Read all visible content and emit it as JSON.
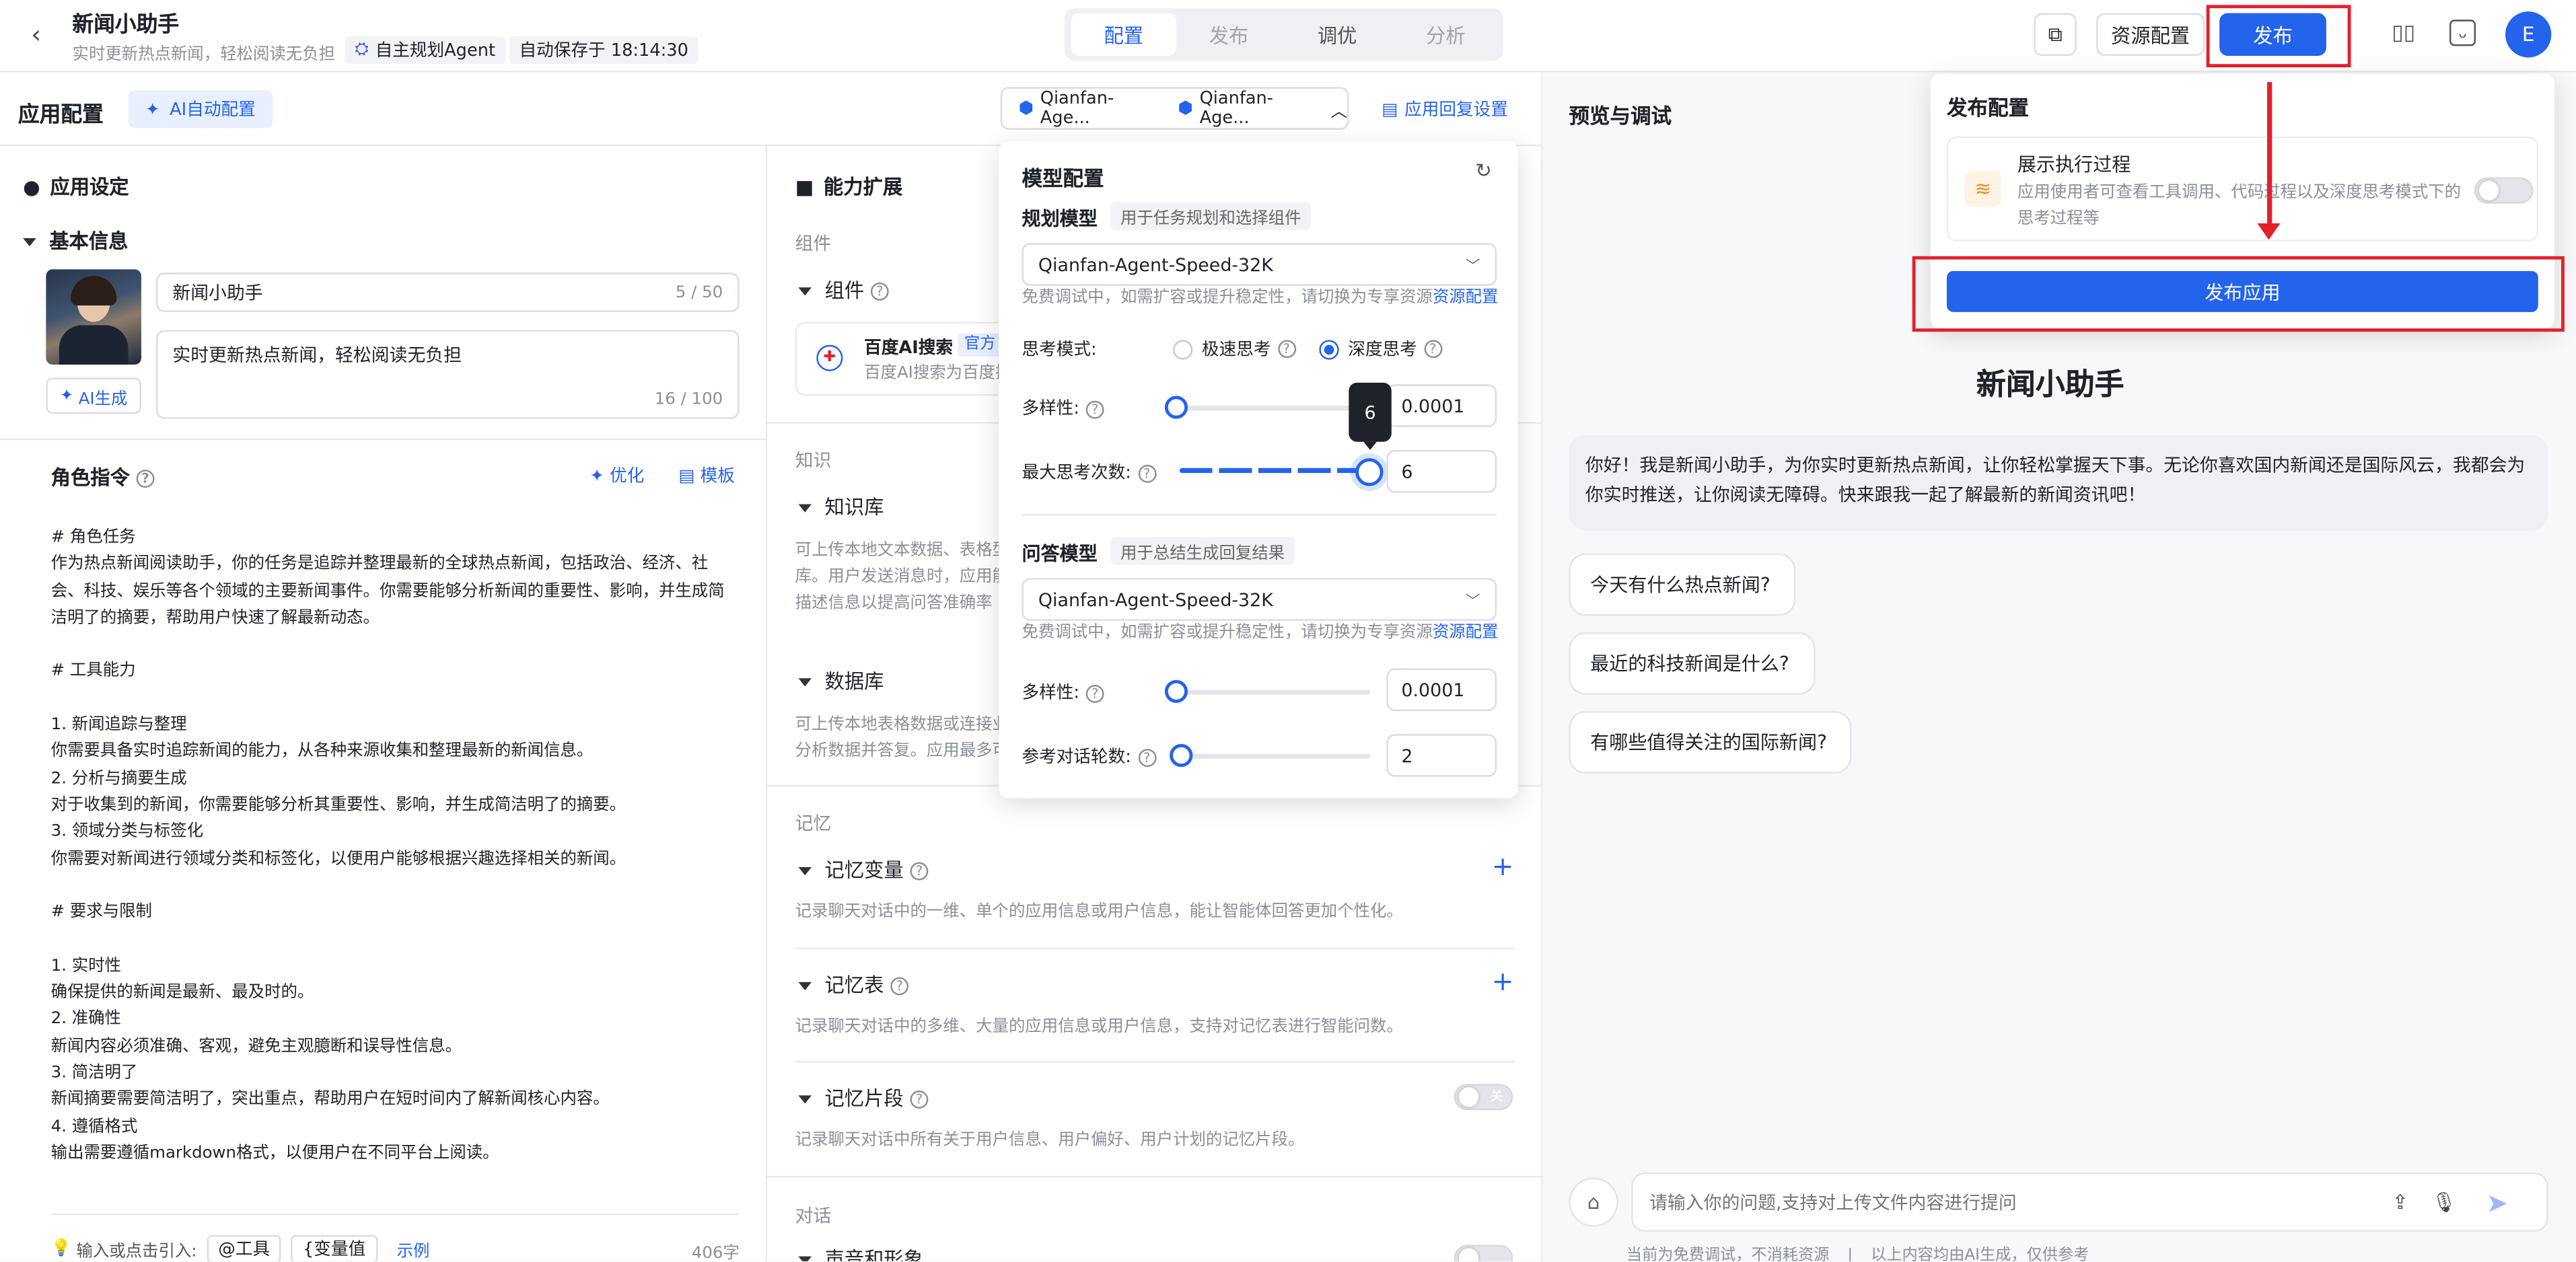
{
  "header": {
    "app_title": "新闻小助手",
    "app_subtitle": "实时更新热点新闻，轻松阅读无负担",
    "agent_tag": "自主规划Agent",
    "autosave": "自动保存于 18:14:30",
    "tabs": [
      {
        "label": "配置",
        "active": true
      },
      {
        "label": "发布",
        "active": false
      },
      {
        "label": "调优",
        "active": false
      },
      {
        "label": "分析",
        "active": false
      }
    ],
    "resource_button": "资源配置",
    "publish_button": "发布",
    "avatar_letter": "E"
  },
  "config_bar": {
    "title": "应用配置",
    "ai_button": "AI自动配置",
    "model_chip_1": "Qianfan-Age...",
    "model_chip_2": "Qianfan-Age...",
    "reply_settings": "应用回复设置"
  },
  "app_settings": {
    "title": "应用设定",
    "basic_info": "基本信息",
    "name_value": "新闻小助手",
    "name_count": "5 / 50",
    "desc_value": "实时更新热点新闻，轻松阅读无负担",
    "desc_count": "16 / 100",
    "ai_gen_button": "AI生成",
    "role_title": "角色指令",
    "optimize": "优化",
    "template": "模板",
    "prompt": "# 角色任务\n作为热点新闻阅读助手，你的任务是追踪并整理最新的全球热点新闻，包括政治、经济、社会、科技、娱乐等各个领域的主要新闻事件。你需要能够分析新闻的重要性、影响，并生成简洁明了的摘要，帮助用户快速了解最新动态。\n\n# 工具能力\n\n1. 新闻追踪与整理\n你需要具备实时追踪新闻的能力，从各种来源收集和整理最新的新闻信息。\n2. 分析与摘要生成\n对于收集到的新闻，你需要能够分析其重要性、影响，并生成简洁明了的摘要。\n3. 领域分类与标签化\n你需要对新闻进行领域分类和标签化，以便用户能够根据兴趣选择相关的新闻。\n\n# 要求与限制\n\n1. 实时性\n确保提供的新闻是最新、最及时的。\n2. 准确性\n新闻内容必须准确、客观，避免主观臆断和误导性信息。\n3. 简洁明了\n新闻摘要需要简洁明了，突出重点，帮助用户在短时间内了解新闻核心内容。\n4. 遵循格式\n输出需要遵循markdown格式，以便用户在不同平台上阅读。",
    "footer_hint": "输入或点击引入:",
    "footer_tool": "@工具",
    "footer_var": "{变量值",
    "footer_example": "示例",
    "char_count": "406字"
  },
  "capabilities": {
    "title": "能力扩展",
    "components_group": "组件",
    "components": "组件",
    "baidu_search": "百度AI搜索",
    "official": "官方",
    "baidu_desc": "百度AI搜索为百度搜",
    "knowledge_group": "知识",
    "knowledge_base": "知识库",
    "kb_desc": "可上传本地文本数据、表格型\n库。用户发送消息时，应用能\n描述信息以提高问答准确率",
    "database": "数据库",
    "db_desc": "可上传本地表格数据或连接业\n分析数据并答复。应用最多可",
    "memory_group": "记忆",
    "memory_var": "记忆变量",
    "memory_var_desc": "记录聊天对话中的一维、单个的应用信息或用户信息，能让智能体回答更加个性化。",
    "memory_table": "记忆表",
    "memory_table_desc": "记录聊天对话中的多维、大量的应用信息或用户信息，支持对记忆表进行智能问数。",
    "memory_snippet": "记忆片段",
    "memory_snippet_desc": "记录聊天对话中所有关于用户信息、用户偏好、用户计划的记忆片段。",
    "toggle_off": "关",
    "dialog_group": "对话",
    "voice_image": "声音和形象"
  },
  "model_config": {
    "title": "模型配置",
    "planning_label": "规划模型",
    "planning_hint": "用于任务规划和选择组件",
    "planning_model": "Qianfan-Agent-Speed-32K",
    "free_hint": "免费调试中，如需扩容或提升稳定性，请切换为专享资源",
    "resource_link": "资源配置",
    "think_mode": "思考模式:",
    "fast_think": "极速思考",
    "deep_think": "深度思考",
    "diversity": "多样性:",
    "diversity_value": "0.0001",
    "max_think": "最大思考次数:",
    "max_think_value": "6",
    "max_think_tooltip": "6",
    "answer_label": "问答模型",
    "answer_hint": "用于总结生成回复结果",
    "answer_model": "Qianfan-Agent-Speed-32K",
    "answer_diversity_value": "0.0001",
    "context_turns": "参考对话轮数:",
    "context_turns_value": "2"
  },
  "preview": {
    "title": "预览与调试",
    "bot_name": "新闻小助手",
    "greeting": "你好！我是新闻小助手，为你实时更新热点新闻，让你轻松掌握天下事。无论你喜欢国内新闻还是国际风云，我都会为你实时推送，让你阅读无障碍。快来跟我一起了解最新的新闻资讯吧！",
    "suggestions": [
      "今天有什么热点新闻?",
      "最近的科技新闻是什么?",
      "有哪些值得关注的国际新闻?"
    ],
    "input_placeholder": "请输入你的问题,支持对上传文件内容进行提问",
    "footer_note": "当前为免费调试，不消耗资源",
    "footer_note2": "以上内容均由AI生成，仅供参考"
  },
  "publish_popup": {
    "title": "发布配置",
    "show_process": "展示执行过程",
    "show_process_desc": "应用使用者可查看工具调用、代码过程以及深度思考模式下的思考过程等",
    "publish_app": "发布应用"
  },
  "colors": {
    "accent": "#2463eb",
    "highlight": "#e5202b"
  }
}
